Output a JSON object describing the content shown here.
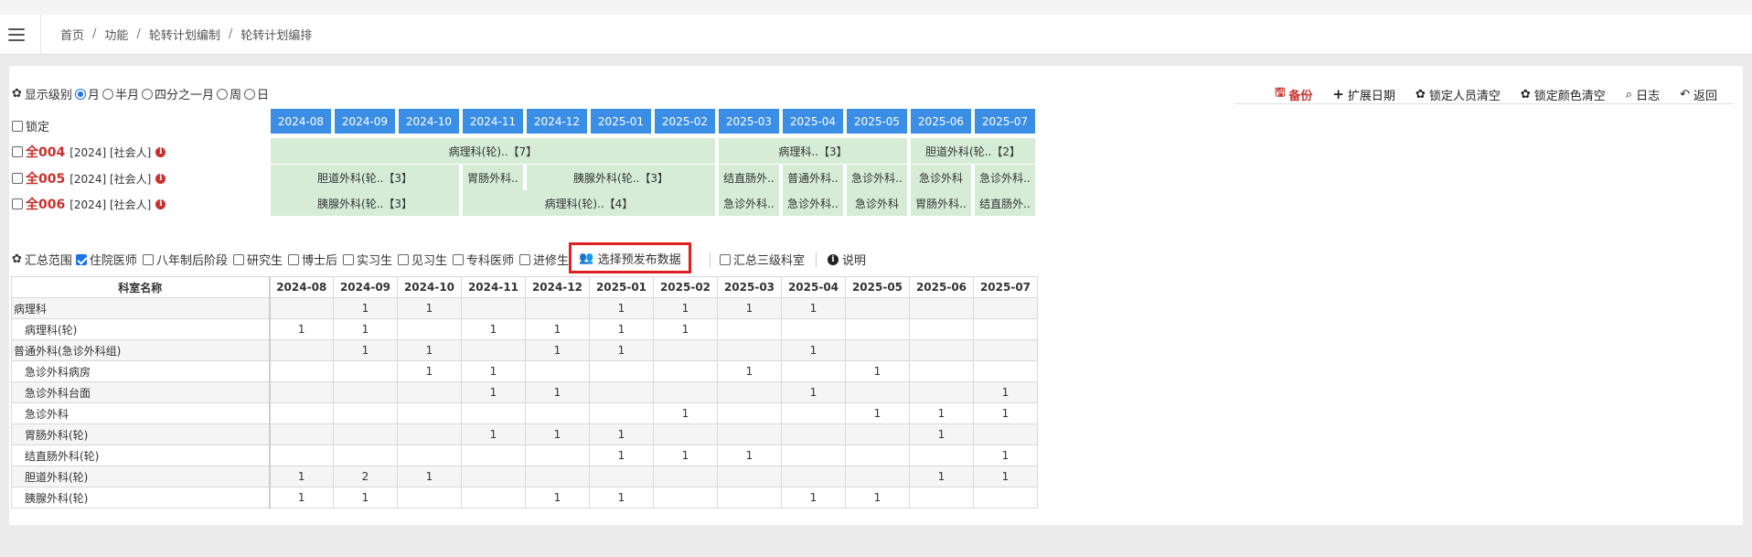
{
  "breadcrumb": [
    "首页",
    "功能",
    "轮转计划编制",
    "轮转计划编排"
  ],
  "display_level": {
    "label": "显示级别",
    "options": [
      {
        "label": "月",
        "checked": true
      },
      {
        "label": "半月",
        "checked": false
      },
      {
        "label": "四分之一月",
        "checked": false
      },
      {
        "label": "周",
        "checked": false
      },
      {
        "label": "日",
        "checked": false
      }
    ]
  },
  "actions": [
    {
      "label": "备份",
      "icon": "save-icon",
      "color": "#c9302c"
    },
    {
      "label": "扩展日期",
      "icon": "plus-icon"
    },
    {
      "label": "锁定人员清空",
      "icon": "gear-icon"
    },
    {
      "label": "锁定颜色清空",
      "icon": "gear-icon"
    },
    {
      "label": "日志",
      "icon": "search-icon"
    },
    {
      "label": "返回",
      "icon": "reply-icon"
    }
  ],
  "lock_label": "锁定",
  "months": [
    "2024-08",
    "2024-09",
    "2024-10",
    "2024-11",
    "2024-12",
    "2025-01",
    "2025-02",
    "2025-03",
    "2025-04",
    "2025-05",
    "2025-06",
    "2025-07"
  ],
  "persons": [
    {
      "name": "全004",
      "meta": "[2024] [社会人]",
      "blocks": [
        {
          "label": "病理科(轮)..【7】",
          "start": 0,
          "span": 7
        },
        {
          "label": "病理科..【3】",
          "start": 7,
          "span": 3
        },
        {
          "label": "胆道外科(轮..【2】",
          "start": 10,
          "span": 2
        }
      ]
    },
    {
      "name": "全005",
      "meta": "[2024] [社会人]",
      "blocks": [
        {
          "label": "胆道外科(轮..【3】",
          "start": 0,
          "span": 3
        },
        {
          "label": "胃肠外科..",
          "start": 3,
          "span": 1
        },
        {
          "label": "胰腺外科(轮..【3】",
          "start": 4,
          "span": 3
        },
        {
          "label": "结直肠外..",
          "start": 7,
          "span": 1
        },
        {
          "label": "普通外科..",
          "start": 8,
          "span": 1
        },
        {
          "label": "急诊外科..",
          "start": 9,
          "span": 1
        },
        {
          "label": "急诊外科",
          "start": 10,
          "span": 1
        },
        {
          "label": "急诊外科..",
          "start": 11,
          "span": 1
        }
      ]
    },
    {
      "name": "全006",
      "meta": "[2024] [社会人]",
      "blocks": [
        {
          "label": "胰腺外科(轮..【3】",
          "start": 0,
          "span": 3
        },
        {
          "label": "病理科(轮)..【4】",
          "start": 3,
          "span": 4
        },
        {
          "label": "急诊外科..",
          "start": 7,
          "span": 1
        },
        {
          "label": "急诊外科..",
          "start": 8,
          "span": 1
        },
        {
          "label": "急诊外科",
          "start": 9,
          "span": 1
        },
        {
          "label": "胃肠外科..",
          "start": 10,
          "span": 1
        },
        {
          "label": "结直肠外..",
          "start": 11,
          "span": 1
        }
      ]
    }
  ],
  "summary": {
    "label": "汇总范围",
    "options": [
      {
        "label": "住院医师",
        "checked": true
      },
      {
        "label": "八年制后阶段",
        "checked": false
      },
      {
        "label": "研究生",
        "checked": false
      },
      {
        "label": "博士后",
        "checked": false
      },
      {
        "label": "实习生",
        "checked": false
      },
      {
        "label": "见习生",
        "checked": false
      },
      {
        "label": "专科医师",
        "checked": false
      },
      {
        "label": "进修生",
        "checked": false
      }
    ],
    "select_button": "选择预发布数据",
    "level3": "汇总三级科室",
    "explain": "说明"
  },
  "table": {
    "name_header": "科室名称",
    "rows": [
      {
        "name": "病理科",
        "indent": false,
        "values": [
          "",
          "1",
          "1",
          "",
          "",
          "1",
          "1",
          "1",
          "1",
          "",
          "",
          ""
        ]
      },
      {
        "name": "病理科(轮)",
        "indent": true,
        "values": [
          "1",
          "1",
          "",
          "1",
          "1",
          "1",
          "1",
          "",
          "",
          "",
          "",
          ""
        ]
      },
      {
        "name": "普通外科(急诊外科组)",
        "indent": false,
        "values": [
          "",
          "1",
          "1",
          "",
          "1",
          "1",
          "",
          "",
          "1",
          "",
          "",
          ""
        ]
      },
      {
        "name": "急诊外科病房",
        "indent": true,
        "values": [
          "",
          "",
          "1",
          "1",
          "",
          "",
          "",
          "1",
          "",
          "1",
          "",
          ""
        ]
      },
      {
        "name": "急诊外科台面",
        "indent": true,
        "values": [
          "",
          "",
          "",
          "1",
          "1",
          "",
          "",
          "",
          "1",
          "",
          "",
          "1"
        ]
      },
      {
        "name": "急诊外科",
        "indent": true,
        "values": [
          "",
          "",
          "",
          "",
          "",
          "",
          "1",
          "",
          "",
          "1",
          "1",
          "1"
        ]
      },
      {
        "name": "胃肠外科(轮)",
        "indent": true,
        "values": [
          "",
          "",
          "",
          "1",
          "1",
          "1",
          "",
          "",
          "",
          "",
          "1",
          ""
        ]
      },
      {
        "name": "结直肠外科(轮)",
        "indent": true,
        "values": [
          "",
          "",
          "",
          "",
          "",
          "1",
          "1",
          "1",
          "",
          "",
          "",
          "1"
        ]
      },
      {
        "name": "胆道外科(轮)",
        "indent": true,
        "values": [
          "1",
          "2",
          "1",
          "",
          "",
          "",
          "",
          "",
          "",
          "",
          "1",
          "1"
        ]
      },
      {
        "name": "胰腺外科(轮)",
        "indent": true,
        "values": [
          "1",
          "1",
          "",
          "",
          "1",
          "1",
          "",
          "",
          "1",
          "1",
          "",
          ""
        ]
      }
    ]
  },
  "colors": {
    "accent": "#3a8ee6",
    "block": "#d6ecd6",
    "danger": "#c9302c",
    "highlight_border": "#e02020"
  }
}
